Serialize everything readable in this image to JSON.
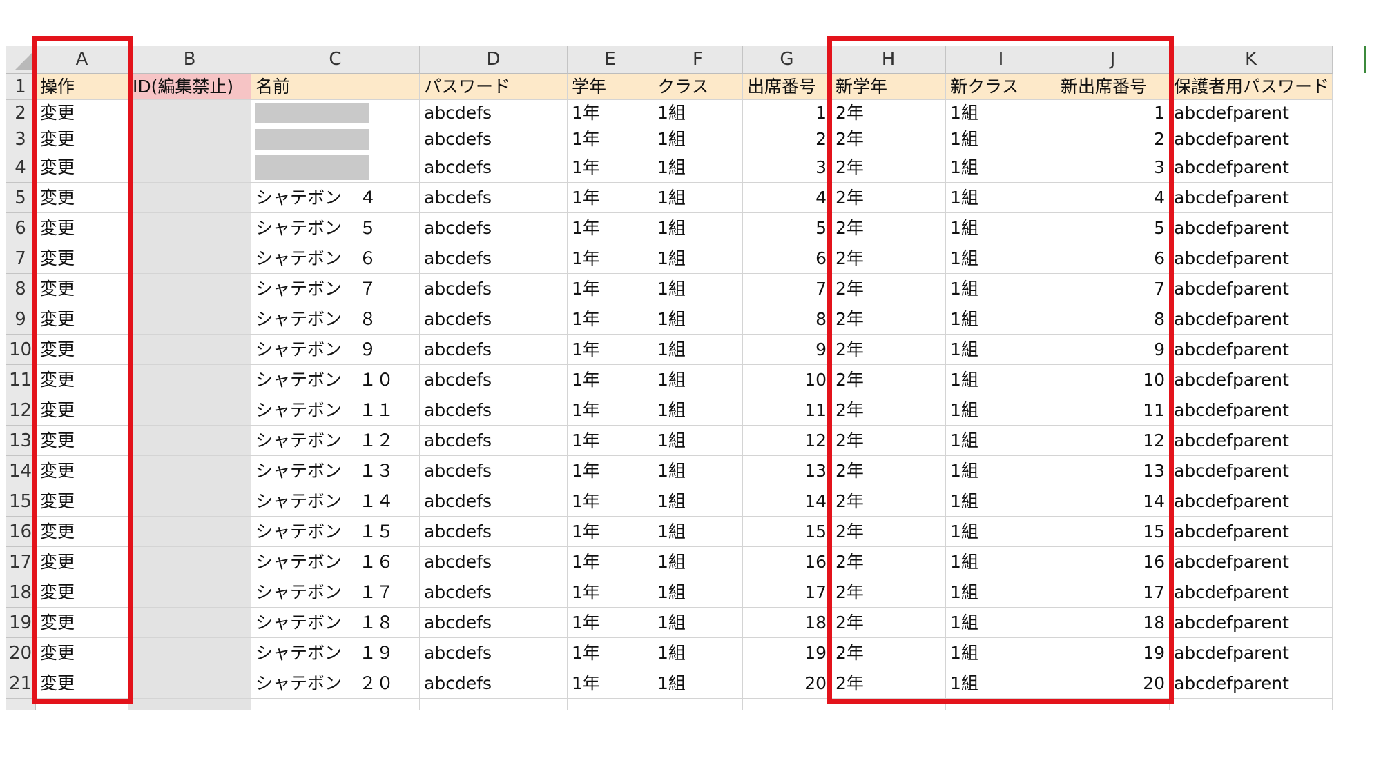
{
  "sheet": {
    "columns": [
      "A",
      "B",
      "C",
      "D",
      "E",
      "F",
      "G",
      "H",
      "I",
      "J",
      "K"
    ],
    "header_row": [
      "操作",
      "ID(編集禁止)",
      "名前",
      "パスワード",
      "学年",
      "クラス",
      "出席番号",
      "新学年",
      "新クラス",
      "新出席番号",
      "保護者用パスワード"
    ],
    "rows": [
      {
        "n": "2",
        "a": "変更",
        "b": "",
        "c": "",
        "d": "abcdefs",
        "e": "1年",
        "f": "1組",
        "g": "1",
        "h": "2年",
        "i": "1組",
        "j": "1",
        "k": "abcdefparent"
      },
      {
        "n": "3",
        "a": "変更",
        "b": "",
        "c": "",
        "d": "abcdefs",
        "e": "1年",
        "f": "1組",
        "g": "2",
        "h": "2年",
        "i": "1組",
        "j": "2",
        "k": "abcdefparent"
      },
      {
        "n": "4",
        "a": "変更",
        "b": "",
        "c": "",
        "d": "abcdefs",
        "e": "1年",
        "f": "1組",
        "g": "3",
        "h": "2年",
        "i": "1組",
        "j": "3",
        "k": "abcdefparent"
      },
      {
        "n": "5",
        "a": "変更",
        "b": "",
        "c": "シャテボン　４",
        "d": "abcdefs",
        "e": "1年",
        "f": "1組",
        "g": "4",
        "h": "2年",
        "i": "1組",
        "j": "4",
        "k": "abcdefparent"
      },
      {
        "n": "6",
        "a": "変更",
        "b": "",
        "c": "シャテボン　５",
        "d": "abcdefs",
        "e": "1年",
        "f": "1組",
        "g": "5",
        "h": "2年",
        "i": "1組",
        "j": "5",
        "k": "abcdefparent"
      },
      {
        "n": "7",
        "a": "変更",
        "b": "",
        "c": "シャテボン　６",
        "d": "abcdefs",
        "e": "1年",
        "f": "1組",
        "g": "6",
        "h": "2年",
        "i": "1組",
        "j": "6",
        "k": "abcdefparent"
      },
      {
        "n": "8",
        "a": "変更",
        "b": "",
        "c": "シャテボン　７",
        "d": "abcdefs",
        "e": "1年",
        "f": "1組",
        "g": "7",
        "h": "2年",
        "i": "1組",
        "j": "7",
        "k": "abcdefparent"
      },
      {
        "n": "9",
        "a": "変更",
        "b": "",
        "c": "シャテボン　８",
        "d": "abcdefs",
        "e": "1年",
        "f": "1組",
        "g": "8",
        "h": "2年",
        "i": "1組",
        "j": "8",
        "k": "abcdefparent"
      },
      {
        "n": "10",
        "a": "変更",
        "b": "",
        "c": "シャテボン　９",
        "d": "abcdefs",
        "e": "1年",
        "f": "1組",
        "g": "9",
        "h": "2年",
        "i": "1組",
        "j": "9",
        "k": "abcdefparent"
      },
      {
        "n": "11",
        "a": "変更",
        "b": "",
        "c": "シャテボン　１０",
        "d": "abcdefs",
        "e": "1年",
        "f": "1組",
        "g": "10",
        "h": "2年",
        "i": "1組",
        "j": "10",
        "k": "abcdefparent"
      },
      {
        "n": "12",
        "a": "変更",
        "b": "",
        "c": "シャテボン　１１",
        "d": "abcdefs",
        "e": "1年",
        "f": "1組",
        "g": "11",
        "h": "2年",
        "i": "1組",
        "j": "11",
        "k": "abcdefparent"
      },
      {
        "n": "13",
        "a": "変更",
        "b": "",
        "c": "シャテボン　１２",
        "d": "abcdefs",
        "e": "1年",
        "f": "1組",
        "g": "12",
        "h": "2年",
        "i": "1組",
        "j": "12",
        "k": "abcdefparent"
      },
      {
        "n": "14",
        "a": "変更",
        "b": "",
        "c": "シャテボン　１３",
        "d": "abcdefs",
        "e": "1年",
        "f": "1組",
        "g": "13",
        "h": "2年",
        "i": "1組",
        "j": "13",
        "k": "abcdefparent"
      },
      {
        "n": "15",
        "a": "変更",
        "b": "",
        "c": "シャテボン　１４",
        "d": "abcdefs",
        "e": "1年",
        "f": "1組",
        "g": "14",
        "h": "2年",
        "i": "1組",
        "j": "14",
        "k": "abcdefparent"
      },
      {
        "n": "16",
        "a": "変更",
        "b": "",
        "c": "シャテボン　１５",
        "d": "abcdefs",
        "e": "1年",
        "f": "1組",
        "g": "15",
        "h": "2年",
        "i": "1組",
        "j": "15",
        "k": "abcdefparent"
      },
      {
        "n": "17",
        "a": "変更",
        "b": "",
        "c": "シャテボン　１６",
        "d": "abcdefs",
        "e": "1年",
        "f": "1組",
        "g": "16",
        "h": "2年",
        "i": "1組",
        "j": "16",
        "k": "abcdefparent"
      },
      {
        "n": "18",
        "a": "変更",
        "b": "",
        "c": "シャテボン　１７",
        "d": "abcdefs",
        "e": "1年",
        "f": "1組",
        "g": "17",
        "h": "2年",
        "i": "1組",
        "j": "17",
        "k": "abcdefparent"
      },
      {
        "n": "19",
        "a": "変更",
        "b": "",
        "c": "シャテボン　１８",
        "d": "abcdefs",
        "e": "1年",
        "f": "1組",
        "g": "18",
        "h": "2年",
        "i": "1組",
        "j": "18",
        "k": "abcdefparent"
      },
      {
        "n": "20",
        "a": "変更",
        "b": "",
        "c": "シャテボン　１９",
        "d": "abcdefs",
        "e": "1年",
        "f": "1組",
        "g": "19",
        "h": "2年",
        "i": "1組",
        "j": "19",
        "k": "abcdefparent"
      },
      {
        "n": "21",
        "a": "変更",
        "b": "",
        "c": "シャテボン　２０",
        "d": "abcdefs",
        "e": "1年",
        "f": "1組",
        "g": "20",
        "h": "2年",
        "i": "1組",
        "j": "20",
        "k": "abcdefparent"
      }
    ],
    "redacted_name_rows": [
      "2",
      "3",
      "4"
    ],
    "locked_column": "B",
    "highlighted_columns": [
      [
        "A"
      ],
      [
        "H",
        "I",
        "J"
      ]
    ]
  },
  "colors": {
    "header_fill": "#fde9c9",
    "locked_header_fill": "#f6c4c5",
    "locked_fill": "#e3e3e3",
    "highlight_border": "#e3131b"
  }
}
